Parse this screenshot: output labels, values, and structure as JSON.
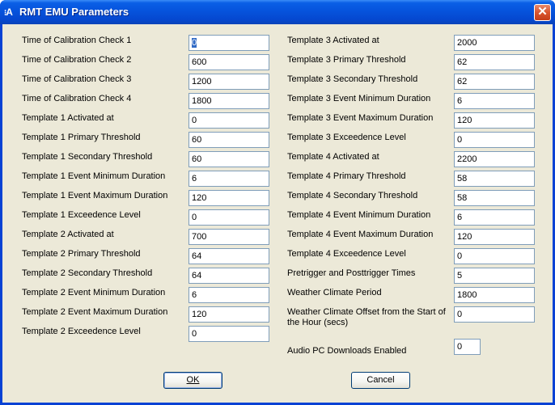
{
  "window": {
    "title": "RMT EMU Parameters",
    "icon_glyph": "A",
    "close_glyph": "✕"
  },
  "left_column": [
    {
      "label": "Time of Calibration Check 1",
      "value": "0"
    },
    {
      "label": "Time of Calibration Check 2",
      "value": "600"
    },
    {
      "label": "Time of Calibration Check 3",
      "value": "1200"
    },
    {
      "label": "Time of Calibration Check 4",
      "value": "1800"
    },
    {
      "label": "Template 1 Activated at",
      "value": "0"
    },
    {
      "label": "Template 1 Primary Threshold",
      "value": "60"
    },
    {
      "label": "Template 1 Secondary Threshold",
      "value": "60"
    },
    {
      "label": "Template 1 Event Minimum Duration",
      "value": "6"
    },
    {
      "label": "Template 1 Event Maximum Duration",
      "value": "120"
    },
    {
      "label": "Template 1 Exceedence Level",
      "value": "0"
    },
    {
      "label": "Template 2 Activated at",
      "value": "700"
    },
    {
      "label": "Template 2 Primary Threshold",
      "value": "64"
    },
    {
      "label": "Template 2 Secondary Threshold",
      "value": "64"
    },
    {
      "label": "Template 2 Event Minimum Duration",
      "value": "6"
    },
    {
      "label": "Template 2 Event Maximum Duration",
      "value": "120"
    },
    {
      "label": "Template 2 Exceedence Level",
      "value": "0"
    }
  ],
  "right_column": [
    {
      "label": "Template 3 Activated at",
      "value": "2000"
    },
    {
      "label": "Template 3 Primary Threshold",
      "value": "62"
    },
    {
      "label": "Template 3 Secondary Threshold",
      "value": "62"
    },
    {
      "label": "Template 3 Event Minimum Duration",
      "value": "6"
    },
    {
      "label": "Template 3 Event Maximum Duration",
      "value": "120"
    },
    {
      "label": "Template 3 Exceedence Level",
      "value": "0"
    },
    {
      "label": "Template 4 Activated at",
      "value": "2200"
    },
    {
      "label": "Template 4 Primary Threshold",
      "value": "58"
    },
    {
      "label": "Template 4 Secondary Threshold",
      "value": "58"
    },
    {
      "label": "Template 4 Event Minimum Duration",
      "value": "6"
    },
    {
      "label": "Template 4 Event Maximum Duration",
      "value": "120"
    },
    {
      "label": "Template 4 Exceedence Level",
      "value": "0"
    },
    {
      "label": "Pretrigger and Posttrigger Times",
      "value": "5"
    },
    {
      "label": "Weather Climate Period",
      "value": "1800"
    },
    {
      "label": "Weather Climate Offset from the Start of the Hour (secs)",
      "value": "0"
    }
  ],
  "audio": {
    "label": "Audio PC Downloads Enabled",
    "value": "0"
  },
  "buttons": {
    "ok": "OK",
    "cancel": "Cancel"
  },
  "colors": {
    "titlebar": "#0653dc",
    "dialog_bg": "#ece9d8",
    "field_border": "#7f9db9",
    "selection": "#316ac5",
    "close_button": "#d9542e"
  }
}
